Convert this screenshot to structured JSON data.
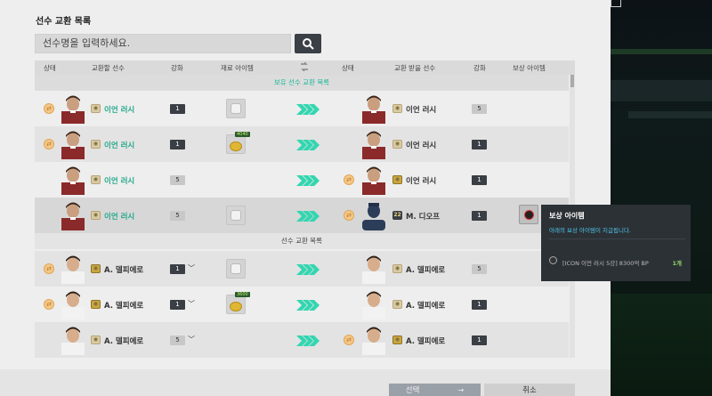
{
  "title": "선수 교환 목록",
  "search": {
    "placeholder": "선수명을 입력하세요."
  },
  "headers": {
    "status": "상태",
    "trade_player": "교환할 선수",
    "enhance": "강화",
    "material": "재료 아이템",
    "status2": "상태",
    "receive_player": "교환 받을 선수",
    "enhance2": "강화",
    "reward": "보상 아이템"
  },
  "sections": {
    "owned": "보유 선수 교환 목록",
    "list": "선수 교환 목록"
  },
  "rows": [
    {
      "left_name": "이언 러시",
      "left_lvl": "1",
      "right_name": "이언 러시",
      "right_lvl": "5"
    },
    {
      "left_name": "이언 러시",
      "left_lvl": "1",
      "material_tag": "4040",
      "right_name": "이언 러시",
      "right_lvl": "1"
    },
    {
      "left_name": "이언 러시",
      "left_lvl": "5",
      "right_name": "이언 러시",
      "right_lvl": "1"
    },
    {
      "left_name": "이언 러시",
      "left_lvl": "5",
      "right_seal": "22",
      "right_name": "M. 디오프",
      "right_lvl": "1"
    },
    {
      "left_name": "A. 델피에로",
      "left_lvl": "1",
      "right_name": "A. 델피에로",
      "right_lvl": "5"
    },
    {
      "left_name": "A. 델피에로",
      "left_lvl": "1",
      "material_tag": "3600",
      "right_name": "A. 델피에로",
      "right_lvl": "1"
    },
    {
      "left_name": "A. 델피에로",
      "left_lvl": "5",
      "right_name": "A. 델피에로",
      "right_lvl": "1"
    }
  ],
  "tooltip": {
    "title": "보상 아이템",
    "desc": "아래의 보상 아이템이 지급됩니다.",
    "item": "[ICON 이언 러시 5강] 8300억 BP",
    "count": "1개"
  },
  "buttons": {
    "select": "선택",
    "cancel": "취소"
  },
  "colors": {
    "accent": "#22a889",
    "panel": "#eeeeee",
    "dark_button": "#3b3f46"
  }
}
